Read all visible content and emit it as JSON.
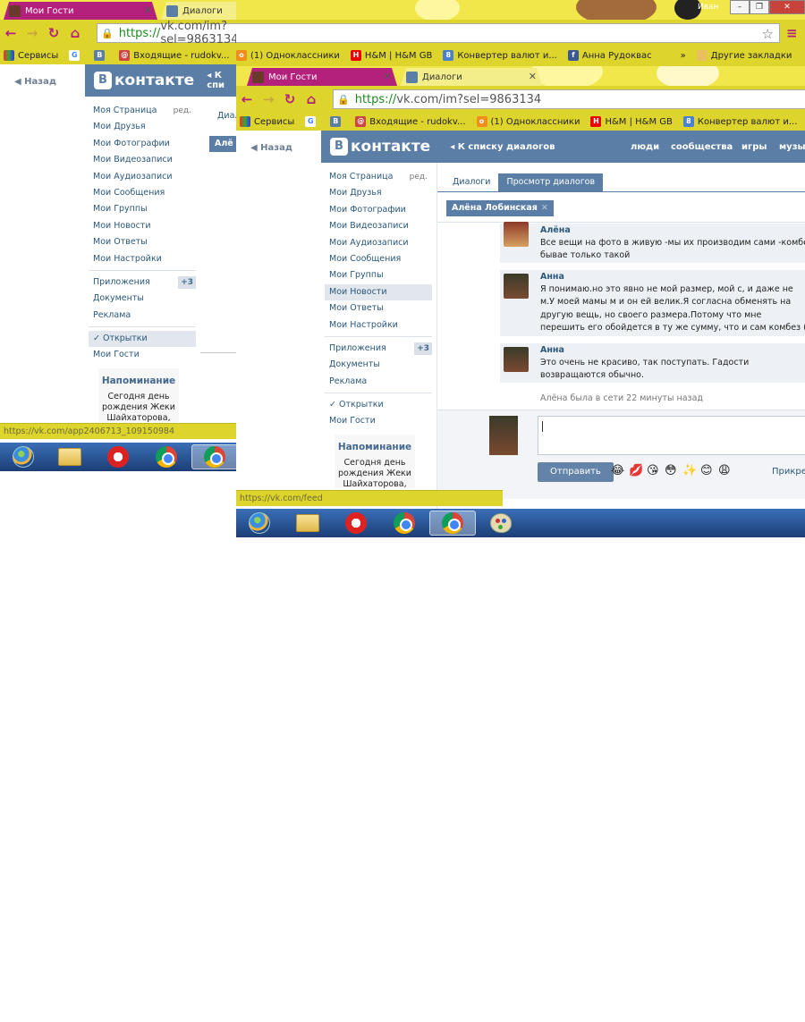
{
  "colors": {
    "chrome_theme_yellow": "#ddd42c",
    "active_tab_magenta": "#b3217d",
    "vk_header_blue": "#5b7ea7",
    "vk_link_blue": "#2b587a"
  },
  "win_a": {
    "tabs": [
      {
        "title": "Мои Гости",
        "icon": "vk-app-icon"
      },
      {
        "title": "Диалоги",
        "icon": "vk-dialog-icon"
      }
    ],
    "user_name": "Иван",
    "url": {
      "scheme": "https://",
      "rest": "vk.com/im?sel=9863134"
    },
    "bookmarks": [
      {
        "label": "Сервисы",
        "icon": "apps-grid-icon"
      },
      {
        "label": "",
        "icon": "google-icon"
      },
      {
        "label": "",
        "icon": "vk-bookmark-icon"
      },
      {
        "label": "Входящие - rudokv...",
        "icon": "mail-icon"
      },
      {
        "label": "(1) Одноклассники",
        "icon": "odnoklassniki-icon"
      },
      {
        "label": "H&M | H&M GB",
        "icon": "hm-icon"
      },
      {
        "label": "Конвертер валют и...",
        "icon": "converter-icon"
      },
      {
        "label": "Анна Рудоквас",
        "icon": "facebook-icon"
      }
    ],
    "more_bookmarks": "»",
    "other_bookmarks": "Другие закладки",
    "back_label": "Назад",
    "header_link": "К спи",
    "menu": [
      {
        "label": "Моя Страница",
        "extra": "ред."
      },
      {
        "label": "Мои Друзья"
      },
      {
        "label": "Мои Фотографии"
      },
      {
        "label": "Мои Видеозаписи"
      },
      {
        "label": "Мои Аудиозаписи"
      },
      {
        "label": "Мои Сообщения"
      },
      {
        "label": "Мои Группы"
      },
      {
        "label": "Мои Новости"
      },
      {
        "label": "Мои Ответы"
      },
      {
        "label": "Мои Настройки"
      }
    ],
    "menu2": [
      {
        "label": "Приложения",
        "badge": "+3"
      },
      {
        "label": "Документы"
      },
      {
        "label": "Реклама"
      }
    ],
    "menu3": [
      {
        "label": "✓ Открытки"
      },
      {
        "label": "Мои Гости"
      }
    ],
    "reminder_title": "Напоминание",
    "reminder_line1": "Сегодня день",
    "reminder_line2": "рождения Жеки",
    "reminder_line3": "Шайхаторова,",
    "subtab_partial": "Диал",
    "chip_partial": "Алё",
    "status_url": "https://vk.com/app2406713_109150984"
  },
  "win_b": {
    "tabs": [
      {
        "title": "Мои Гости",
        "icon": "vk-app-icon"
      },
      {
        "title": "Диалоги",
        "icon": "vk-dialog-icon"
      }
    ],
    "url": {
      "scheme": "https://",
      "rest": "vk.com/im?sel=9863134"
    },
    "bookmarks": [
      {
        "label": "Сервисы",
        "icon": "apps-grid-icon"
      },
      {
        "label": "",
        "icon": "google-icon"
      },
      {
        "label": "",
        "icon": "vk-bookmark-icon"
      },
      {
        "label": "Входящие - rudokv...",
        "icon": "mail-icon"
      },
      {
        "label": "(1) Одноклассники",
        "icon": "odnoklassniki-icon"
      },
      {
        "label": "H&M | H&M GB",
        "icon": "hm-icon"
      },
      {
        "label": "Конвертер валют и...",
        "icon": "converter-icon"
      }
    ],
    "back_label": "Назад",
    "logo_text": "контакте",
    "back_to_dialogs": "К списку диалогов",
    "nav": [
      "люди",
      "сообщества",
      "игры",
      "музы"
    ],
    "menu": [
      {
        "label": "Моя Страница",
        "extra": "ред."
      },
      {
        "label": "Мои Друзья"
      },
      {
        "label": "Мои Фотографии"
      },
      {
        "label": "Мои Видеозаписи"
      },
      {
        "label": "Мои Аудиозаписи"
      },
      {
        "label": "Мои Сообщения"
      },
      {
        "label": "Мои Группы"
      },
      {
        "label": "Мои Новости"
      },
      {
        "label": "Мои Ответы"
      },
      {
        "label": "Мои Настройки"
      }
    ],
    "menu2": [
      {
        "label": "Приложения",
        "badge": "+3"
      },
      {
        "label": "Документы"
      },
      {
        "label": "Реклама"
      }
    ],
    "menu3": [
      {
        "label": "✓ Открытки"
      },
      {
        "label": "Мои Гости"
      }
    ],
    "reminder_title": "Напоминание",
    "reminder_line1": "Сегодня день",
    "reminder_line2": "рождения Жеки",
    "reminder_line3": "Шайхаторова,",
    "subtabs": [
      "Диалоги",
      "Просмотр диалогов"
    ],
    "chip_name": "Алёна Лобинская",
    "chip_close": "✕",
    "messages": [
      {
        "author": "Алёна",
        "text": "Все вещи на фото в живую -мы их производим сами -комбез бывае только такой"
      },
      {
        "author": "Анна",
        "text": "Я понимаю.но это явно не мой размер, мой с, и даже не м.У моей мамы м и он ей велик.Я согласна обменять на другую вещь, но своего размера.Потому что мне перешить его обойдется в ту же сумму, что и сам комбез ("
      },
      {
        "author": "Анна",
        "text": "Это очень не красиво, так поступать. Гадости возвращаются обычно."
      }
    ],
    "online_status": "Алёна была в сети 22 минуты назад",
    "send_label": "Отправить",
    "emojis": [
      "😂",
      "💋",
      "😘",
      "😳",
      "✨",
      "😊",
      "😩"
    ],
    "attach_label": "Прикреп",
    "status_url": "https://vk.com/feed"
  }
}
